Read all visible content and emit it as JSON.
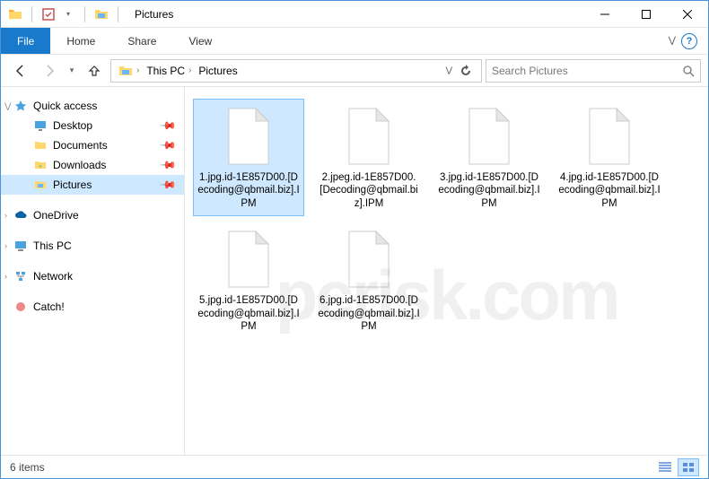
{
  "window": {
    "title": "Pictures"
  },
  "ribbon": {
    "file": "File",
    "tabs": [
      "Home",
      "Share",
      "View"
    ]
  },
  "breadcrumb": {
    "items": [
      "This PC",
      "Pictures"
    ]
  },
  "search": {
    "placeholder": "Search Pictures"
  },
  "sidebar": {
    "quick_access": {
      "label": "Quick access",
      "items": [
        {
          "label": "Desktop",
          "icon": "desktop",
          "pinned": true
        },
        {
          "label": "Documents",
          "icon": "folder",
          "pinned": true
        },
        {
          "label": "Downloads",
          "icon": "folder",
          "pinned": true
        },
        {
          "label": "Pictures",
          "icon": "folder",
          "pinned": true,
          "selected": true
        }
      ]
    },
    "onedrive": {
      "label": "OneDrive"
    },
    "thispc": {
      "label": "This PC"
    },
    "network": {
      "label": "Network"
    },
    "catch": {
      "label": "Catch!"
    }
  },
  "files": [
    {
      "name": "1.jpg.id-1E857D00.[Decoding@qbmail.biz].IPM",
      "selected": true
    },
    {
      "name": "2.jpeg.id-1E857D00.[Decoding@qbmail.biz].IPM"
    },
    {
      "name": "3.jpg.id-1E857D00.[Decoding@qbmail.biz].IPM"
    },
    {
      "name": "4.jpg.id-1E857D00.[Decoding@qbmail.biz].IPM"
    },
    {
      "name": "5.jpg.id-1E857D00.[Decoding@qbmail.biz].IPM"
    },
    {
      "name": "6.jpg.id-1E857D00.[Decoding@qbmail.biz].IPM"
    }
  ],
  "statusbar": {
    "count_text": "6 items"
  },
  "watermark": "pcrisk.com"
}
